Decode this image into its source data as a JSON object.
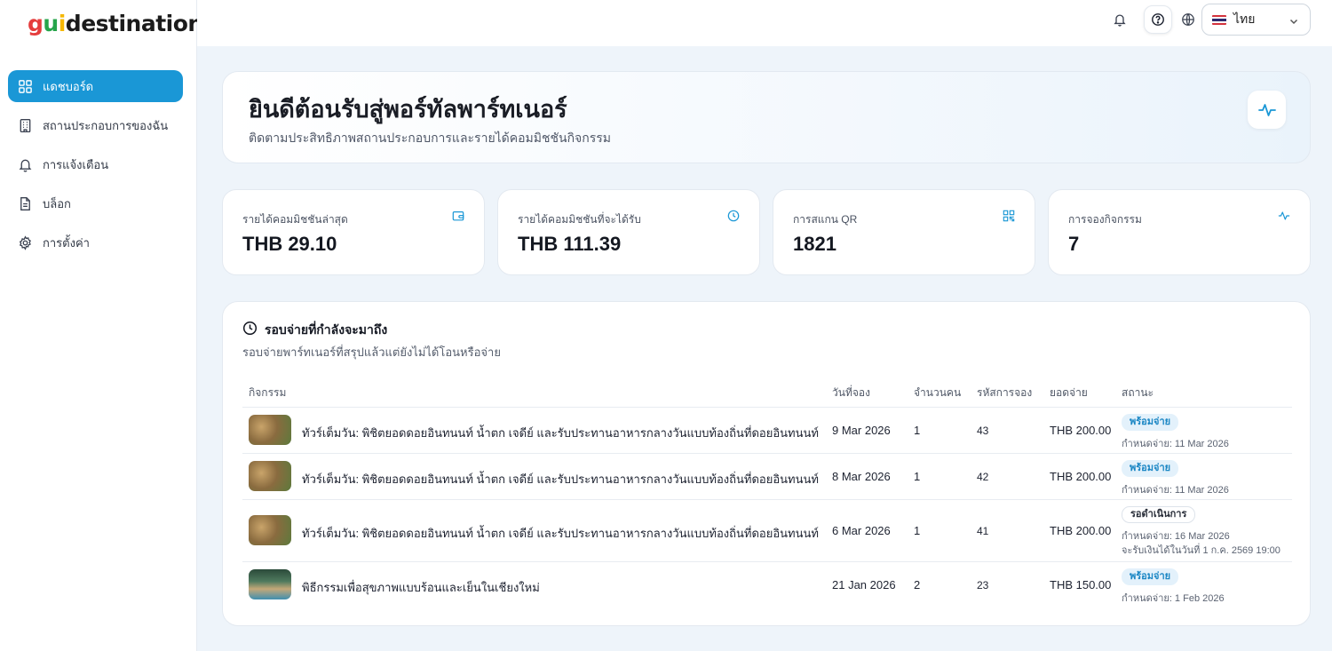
{
  "brand": {
    "logo_g": "g",
    "logo_u": "u",
    "logo_i": "i",
    "logo_rest": "destination"
  },
  "sidebar": {
    "items": [
      {
        "label": "แดชบอร์ด",
        "icon": "dashboard-grid-icon",
        "active": true
      },
      {
        "label": "สถานประกอบการของฉัน",
        "icon": "building-icon",
        "active": false
      },
      {
        "label": "การแจ้งเตือน",
        "icon": "bell-icon",
        "active": false
      },
      {
        "label": "บล็อก",
        "icon": "document-icon",
        "active": false
      },
      {
        "label": "การตั้งค่า",
        "icon": "gear-icon",
        "active": false
      }
    ]
  },
  "topbar": {
    "language": "ไทย",
    "icons": [
      "bell-icon",
      "help-circle-icon",
      "globe-icon",
      "thailand-flag-icon",
      "chevron-down-icon"
    ]
  },
  "welcome": {
    "title": "ยินดีต้อนรับสู่พอร์ทัลพาร์ทเนอร์",
    "subtitle": "ติดตามประสิทธิภาพสถานประกอบการและรายได้คอมมิชชันกิจกรรม"
  },
  "stats": [
    {
      "label": "รายได้คอมมิชชันล่าสุด",
      "value": "THB 29.10",
      "icon": "wallet-icon"
    },
    {
      "label": "รายได้คอมมิชชันที่จะได้รับ",
      "value": "THB 111.39",
      "icon": "clock-icon"
    },
    {
      "label": "การสแกน QR",
      "value": "1821",
      "icon": "qr-code-icon"
    },
    {
      "label": "การจองกิจกรรม",
      "value": "7",
      "icon": "activity-pulse-icon"
    }
  ],
  "payout": {
    "title": "รอบจ่ายที่กำลังจะมาถึง",
    "subtitle": "รอบจ่ายพาร์ทเนอร์ที่สรุปแล้วแต่ยังไม่ได้โอนหรือจ่าย",
    "columns": [
      "กิจกรรม",
      "วันที่จอง",
      "จำนวนคน",
      "รหัสการจอง",
      "ยอดจ่าย",
      "สถานะ"
    ],
    "rows": [
      {
        "activity": "ทัวร์เต็มวัน: พิชิตยอดดอยอินทนนท์ น้ำตก เจดีย์ และรับประทานอาหารกลางวันแบบท้องถิ่นที่ดอยอินทนนท์",
        "date": "9 Mar 2026",
        "people": "1",
        "booking": "43",
        "amount": "THB 200.00",
        "status": "พร้อมจ่าย",
        "status_kind": "ready",
        "due": "กำหนดจ่าย: 11 Mar 2026",
        "note": ""
      },
      {
        "activity": "ทัวร์เต็มวัน: พิชิตยอดดอยอินทนนท์ น้ำตก เจดีย์ และรับประทานอาหารกลางวันแบบท้องถิ่นที่ดอยอินทนนท์",
        "date": "8 Mar 2026",
        "people": "1",
        "booking": "42",
        "amount": "THB 200.00",
        "status": "พร้อมจ่าย",
        "status_kind": "ready",
        "due": "กำหนดจ่าย: 11 Mar 2026",
        "note": ""
      },
      {
        "activity": "ทัวร์เต็มวัน: พิชิตยอดดอยอินทนนท์ น้ำตก เจดีย์ และรับประทานอาหารกลางวันแบบท้องถิ่นที่ดอยอินทนนท์",
        "date": "6 Mar 2026",
        "people": "1",
        "booking": "41",
        "amount": "THB 200.00",
        "status": "รอดำเนินการ",
        "status_kind": "wait",
        "due": "กำหนดจ่าย: 16 Mar 2026",
        "note": "จะรับเงินได้ในวันที่ 1 ก.ค. 2569 19:00"
      },
      {
        "activity": "พิธีกรรมเพื่อสุขภาพแบบร้อนและเย็นในเชียงใหม่",
        "date": "21 Jan 2026",
        "people": "2",
        "booking": "23",
        "amount": "THB 150.00",
        "status": "พร้อมจ่าย",
        "status_kind": "ready",
        "due": "กำหนดจ่าย: 1 Feb 2026",
        "note": ""
      }
    ]
  },
  "colors": {
    "accent": "#1a97d6",
    "ready_badge_bg": "#e3f1fb",
    "ready_badge_text": "#1a86c4"
  }
}
